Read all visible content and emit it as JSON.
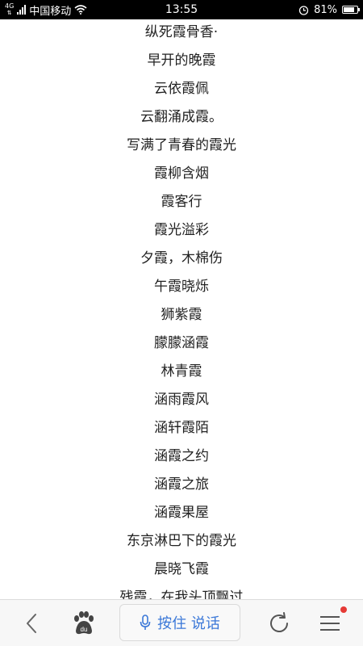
{
  "status_bar": {
    "network": "4G",
    "carrier": "中国移动",
    "time": "13:55",
    "battery": "81%",
    "battery_level": 0.81
  },
  "lines": [
    "纵死霞骨香·",
    "早开的晚霞",
    "云依霞佩",
    "云翻涌成霞。",
    "写满了青春的霞光",
    "霞柳含烟",
    "霞客行",
    "霞光溢彩",
    "夕霞，木棉伤",
    "午霞晓烁",
    "狮紫霞",
    "朦朦涵霞",
    "林青霞",
    "涵雨霞风",
    "涵轩霞陌",
    "涵霞之约",
    "涵霞之旅",
    "涵霞果屋",
    "东京淋巴下的霞光",
    "晨晓飞霞",
    "残霞，在我头顶飘过"
  ],
  "toolbar": {
    "voice_label": "按住 说话",
    "accent": "#3b78d8",
    "badge_color": "#e53935"
  }
}
